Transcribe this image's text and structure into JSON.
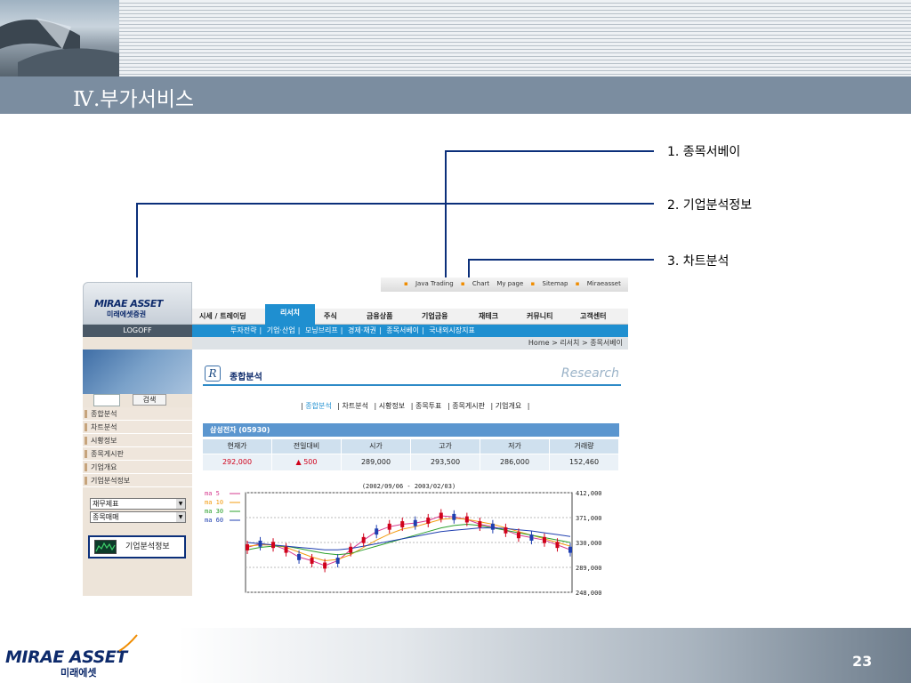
{
  "slide": {
    "title": "Ⅳ.부가서비스",
    "page_number": "23",
    "footer_logo_en": "MIRAE ASSET",
    "footer_logo_ko": "미래에셋"
  },
  "callouts": [
    "1. 종목서베이",
    "2. 기업분석정보",
    "3. 차트분석"
  ],
  "colors": {
    "title_band": "#7b8da0",
    "callout_line": "#0b2f7a",
    "nav_blue": "#1f8fd0",
    "up_red": "#d0021b"
  },
  "site": {
    "logo_en": "MIRAE ASSET",
    "logo_ko": "미래에셋증권",
    "logoff": "LOGOFF",
    "top_links": [
      "Java Trading",
      "Chart",
      "My page",
      "Sitemap",
      "Miraeasset"
    ],
    "main_nav": [
      "시세 / 트레이딩",
      "리서치",
      "주식",
      "금융상품",
      "기업금융",
      "재테크",
      "커뮤니티",
      "고객센터"
    ],
    "active_nav": "리서치",
    "sub_nav": [
      "투자전략",
      "기업·산업",
      "모닝브리프",
      "경제·채권",
      "종목서베이",
      "국내외시장지표"
    ],
    "breadcrumb": "Home > 리서치 > 종목서베이",
    "search_button": "검색",
    "left_menu": [
      "종합분석",
      "차트분석",
      "시황정보",
      "종목게시판",
      "기업개요",
      "기업분석정보"
    ],
    "select_1": "재무제표",
    "select_2": "종목매매",
    "info_button": "기업분석정보",
    "section_title": "종합분석",
    "research_label": "Research",
    "tabs": [
      "종합분석",
      "차트분석",
      "시황정보",
      "종목투표",
      "종목게시판",
      "기업개요"
    ],
    "active_tab": "종합분석",
    "stock_header": "삼성전자 (05930)",
    "table": {
      "headers": [
        "현재가",
        "전일대비",
        "시가",
        "고가",
        "저가",
        "거래량"
      ],
      "values": [
        "292,000",
        "▲  500",
        "289,000",
        "293,500",
        "286,000",
        "152,460"
      ]
    }
  },
  "chart_data": {
    "type": "line",
    "title": "(2002/09/06 - 2003/02/03)",
    "legend": [
      "ma 5",
      "ma 10",
      "ma 30",
      "ma 60"
    ],
    "legend_colors": [
      "#d63b8f",
      "#f39c12",
      "#2ca02c",
      "#1f3fb0"
    ],
    "y_ticks": [
      "412,000",
      "371,000",
      "330,000",
      "289,000",
      "248,000"
    ],
    "ylim": [
      248000,
      412000
    ],
    "series": [
      {
        "name": "ma 5",
        "values": [
          322000,
          328000,
          326000,
          318000,
          306000,
          300000,
          292000,
          300000,
          318000,
          334000,
          348000,
          356000,
          360000,
          362000,
          366000,
          374000,
          372000,
          368000,
          360000,
          356000,
          350000,
          342000,
          338000,
          334000,
          326000,
          318000
        ]
      },
      {
        "name": "ma 10",
        "values": [
          324000,
          326000,
          326000,
          322000,
          314000,
          306000,
          300000,
          302000,
          310000,
          322000,
          334000,
          344000,
          352000,
          356000,
          362000,
          368000,
          370000,
          368000,
          364000,
          360000,
          354000,
          348000,
          342000,
          336000,
          330000,
          324000
        ]
      },
      {
        "name": "ma 30",
        "values": [
          318000,
          322000,
          324000,
          324000,
          320000,
          316000,
          312000,
          310000,
          312000,
          318000,
          324000,
          330000,
          336000,
          342000,
          348000,
          354000,
          358000,
          360000,
          358000,
          354000,
          350000,
          346000,
          342000,
          338000,
          334000,
          330000
        ]
      },
      {
        "name": "ma 60",
        "values": [
          330000,
          328000,
          326000,
          324000,
          322000,
          320000,
          318000,
          318000,
          320000,
          324000,
          328000,
          332000,
          336000,
          340000,
          344000,
          348000,
          350000,
          352000,
          354000,
          354000,
          353000,
          351000,
          349000,
          346000,
          343000,
          340000
        ]
      }
    ]
  }
}
